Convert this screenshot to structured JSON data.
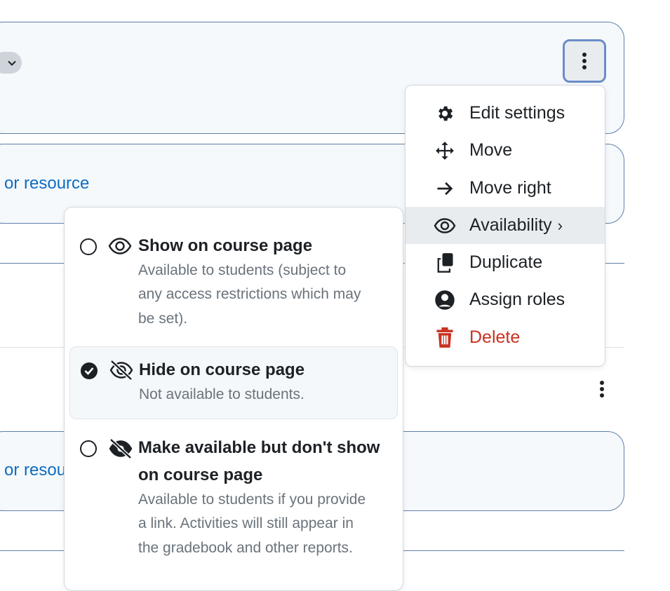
{
  "background_cards": {
    "link_text_1": "or resource",
    "link_text_2": "or resou"
  },
  "action_menu": {
    "items": [
      {
        "label": "Edit settings",
        "icon": "gear-icon"
      },
      {
        "label": "Move",
        "icon": "move-arrows-icon"
      },
      {
        "label": "Move right",
        "icon": "arrow-right-icon"
      },
      {
        "label": "Availability",
        "icon": "eye-icon",
        "chevron": "›",
        "active": true
      },
      {
        "label": "Duplicate",
        "icon": "copy-icon"
      },
      {
        "label": "Assign roles",
        "icon": "user-circle-icon"
      },
      {
        "label": "Delete",
        "icon": "trash-icon",
        "color": "#ca3120"
      }
    ]
  },
  "availability_submenu": {
    "options": [
      {
        "title": "Show on course page",
        "desc_lines": [
          "Available to students (subject to",
          "any access restrictions which may",
          "be set)."
        ],
        "icon": "eye-icon",
        "selected": false
      },
      {
        "title": "Hide on course page",
        "desc_lines": [
          "Not available to students."
        ],
        "icon": "eye-slash-icon",
        "selected": true
      },
      {
        "title_lines": [
          "Make available but don't show",
          "on course page"
        ],
        "desc_lines": [
          "Available to students if you provide",
          "a link. Activities will still appear in",
          "the gradebook and other reports."
        ],
        "icon": "eye-hidden-icon",
        "selected": false
      }
    ]
  },
  "colors": {
    "accent": "#0f6cbf",
    "danger": "#ca3120",
    "card_border": "#5f7fa8",
    "focus_ring": "#6a8dc8"
  }
}
